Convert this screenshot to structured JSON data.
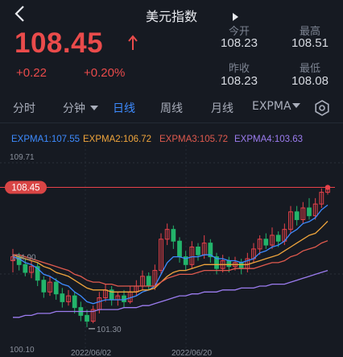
{
  "header": {
    "title": "美元指数"
  },
  "quote": {
    "price": "108.45",
    "change": "+0.22",
    "change_pct": "+0.20%",
    "stats": [
      {
        "label": "今开",
        "value": "108.23"
      },
      {
        "label": "最高",
        "value": "108.51"
      },
      {
        "label": "昨收",
        "value": "108.23"
      },
      {
        "label": "最低",
        "value": "108.08"
      }
    ]
  },
  "tabs": [
    {
      "label": "分时",
      "active": false
    },
    {
      "label": "分钟",
      "active": false,
      "dropdown": true
    },
    {
      "label": "日线",
      "active": true
    },
    {
      "label": "周线",
      "active": false
    },
    {
      "label": "月线",
      "active": false
    },
    {
      "label": "EXPMA",
      "active": false,
      "dropdown": true
    }
  ],
  "icons": {
    "back": "chevron-left-icon",
    "play": "play-icon",
    "settings": "gear-icon",
    "trend": "arrow-up-icon"
  },
  "colors": {
    "up": "#e8424a",
    "down": "#23b46b",
    "expma1": "#3d8bff",
    "expma2": "#f0a53c",
    "expma3": "#e05a4e",
    "expma4": "#9c7cf0"
  },
  "chart_data": {
    "type": "candlestick",
    "legend": [
      "EXPMA1:107.55",
      "EXPMA2:106.72",
      "EXPMA3:105.72",
      "EXPMA4:103.63"
    ],
    "price_tag": "108.45",
    "y_labels": [
      "109.71",
      "104.90",
      "100.10"
    ],
    "min_label": "101.30",
    "x_labels": [
      "2022/06/02",
      "2022/06/20"
    ],
    "ylim": [
      100.1,
      109.71
    ],
    "candles": [
      [
        104.7,
        104.9,
        105.3,
        104.1
      ],
      [
        104.9,
        104.5,
        105.1,
        104.2
      ],
      [
        104.5,
        104.1,
        104.8,
        103.9
      ],
      [
        104.1,
        104.4,
        104.7,
        103.8
      ],
      [
        104.4,
        103.7,
        104.6,
        103.4
      ],
      [
        103.7,
        103.1,
        103.9,
        102.8
      ],
      [
        103.1,
        103.6,
        103.9,
        102.9
      ],
      [
        103.6,
        103.0,
        103.8,
        102.7
      ],
      [
        103.0,
        102.6,
        103.3,
        102.3
      ],
      [
        102.6,
        102.9,
        103.2,
        102.4
      ],
      [
        102.9,
        102.3,
        103.1,
        102.0
      ],
      [
        102.3,
        101.9,
        102.6,
        101.6
      ],
      [
        101.9,
        101.6,
        102.2,
        101.3
      ],
      [
        101.6,
        102.2,
        102.4,
        101.5
      ],
      [
        102.2,
        102.8,
        103.1,
        102.0
      ],
      [
        102.8,
        103.2,
        103.5,
        102.6
      ],
      [
        103.2,
        102.7,
        103.4,
        102.4
      ],
      [
        102.7,
        102.9,
        103.1,
        102.4
      ],
      [
        102.9,
        102.6,
        103.2,
        102.3
      ],
      [
        102.6,
        103.1,
        103.4,
        102.5
      ],
      [
        103.1,
        103.4,
        103.7,
        102.9
      ],
      [
        103.4,
        103.9,
        104.2,
        103.2
      ],
      [
        103.9,
        103.4,
        104.1,
        103.2
      ],
      [
        103.4,
        104.2,
        104.5,
        103.2
      ],
      [
        104.2,
        105.8,
        106.1,
        104.0
      ],
      [
        105.8,
        106.3,
        106.6,
        105.5
      ],
      [
        106.3,
        105.7,
        106.5,
        105.3
      ],
      [
        105.7,
        104.9,
        105.9,
        104.6
      ],
      [
        104.9,
        104.5,
        105.2,
        104.2
      ],
      [
        104.5,
        105.4,
        105.7,
        104.3
      ],
      [
        105.4,
        105.0,
        105.6,
        104.7
      ],
      [
        105.0,
        105.6,
        106.0,
        104.8
      ],
      [
        105.6,
        104.9,
        105.8,
        104.6
      ],
      [
        104.9,
        104.3,
        105.1,
        104.0
      ],
      [
        104.3,
        104.7,
        105.0,
        104.1
      ],
      [
        104.7,
        104.4,
        104.9,
        104.1
      ],
      [
        104.4,
        104.6,
        104.9,
        104.2
      ],
      [
        104.6,
        104.3,
        104.8,
        104.0
      ],
      [
        104.3,
        104.8,
        105.1,
        104.1
      ],
      [
        104.8,
        105.3,
        105.6,
        104.6
      ],
      [
        105.3,
        105.8,
        106.0,
        105.0
      ],
      [
        105.8,
        105.5,
        106.1,
        105.3
      ],
      [
        105.5,
        106.0,
        106.4,
        105.3
      ],
      [
        106.0,
        105.7,
        106.2,
        105.4
      ],
      [
        105.7,
        106.3,
        106.6,
        105.5
      ],
      [
        106.3,
        107.2,
        107.5,
        106.1
      ],
      [
        107.2,
        106.8,
        107.5,
        106.5
      ],
      [
        106.8,
        107.4,
        107.7,
        106.6
      ],
      [
        107.4,
        107.0,
        107.9,
        106.8
      ],
      [
        107.0,
        107.6,
        107.9,
        106.8
      ],
      [
        107.6,
        108.2,
        108.4,
        107.4
      ],
      [
        108.2,
        108.45,
        108.51,
        108.08
      ]
    ],
    "expma1": [
      104.9,
      104.8,
      104.6,
      104.5,
      104.3,
      104.0,
      103.9,
      103.7,
      103.5,
      103.4,
      103.1,
      102.9,
      102.6,
      102.5,
      102.6,
      102.7,
      102.7,
      102.7,
      102.7,
      102.8,
      102.9,
      103.1,
      103.2,
      103.4,
      104.0,
      104.6,
      104.9,
      104.9,
      104.8,
      104.9,
      104.9,
      105.0,
      105.0,
      104.8,
      104.8,
      104.7,
      104.7,
      104.6,
      104.7,
      104.8,
      105.1,
      105.2,
      105.4,
      105.5,
      105.7,
      106.1,
      106.3,
      106.6,
      106.7,
      106.9,
      107.3,
      107.55
    ],
    "expma2": [
      105.0,
      104.9,
      104.8,
      104.7,
      104.6,
      104.4,
      104.3,
      104.1,
      104.0,
      103.9,
      103.7,
      103.5,
      103.3,
      103.2,
      103.2,
      103.2,
      103.1,
      103.1,
      103.1,
      103.1,
      103.1,
      103.2,
      103.2,
      103.3,
      103.6,
      103.9,
      104.1,
      104.2,
      104.2,
      104.3,
      104.4,
      104.5,
      104.5,
      104.5,
      104.5,
      104.5,
      104.5,
      104.5,
      104.5,
      104.6,
      104.7,
      104.8,
      104.9,
      105.0,
      105.2,
      105.4,
      105.6,
      105.8,
      106.0,
      106.1,
      106.4,
      106.72
    ],
    "expma3": [
      105.0,
      105.0,
      104.9,
      104.8,
      104.7,
      104.6,
      104.5,
      104.4,
      104.3,
      104.2,
      104.0,
      103.9,
      103.7,
      103.6,
      103.6,
      103.5,
      103.5,
      103.4,
      103.4,
      103.4,
      103.4,
      103.4,
      103.4,
      103.4,
      103.6,
      103.8,
      103.9,
      104.0,
      104.0,
      104.0,
      104.1,
      104.2,
      104.2,
      104.2,
      104.2,
      104.2,
      104.3,
      104.3,
      104.3,
      104.3,
      104.4,
      104.5,
      104.6,
      104.6,
      104.7,
      104.9,
      105.0,
      105.2,
      105.3,
      105.4,
      105.6,
      105.72
    ],
    "expma4": [
      101.8,
      101.8,
      101.9,
      101.9,
      102.0,
      102.0,
      102.0,
      102.1,
      102.1,
      102.1,
      102.1,
      102.1,
      102.1,
      102.1,
      102.2,
      102.2,
      102.2,
      102.2,
      102.3,
      102.3,
      102.3,
      102.4,
      102.4,
      102.5,
      102.6,
      102.7,
      102.8,
      102.9,
      102.9,
      103.0,
      103.0,
      103.1,
      103.1,
      103.1,
      103.2,
      103.2,
      103.2,
      103.3,
      103.3,
      103.3,
      103.4,
      103.4,
      103.5,
      103.5,
      103.5,
      103.6,
      103.7,
      103.8,
      103.9,
      104.0,
      104.1,
      104.2
    ]
  }
}
